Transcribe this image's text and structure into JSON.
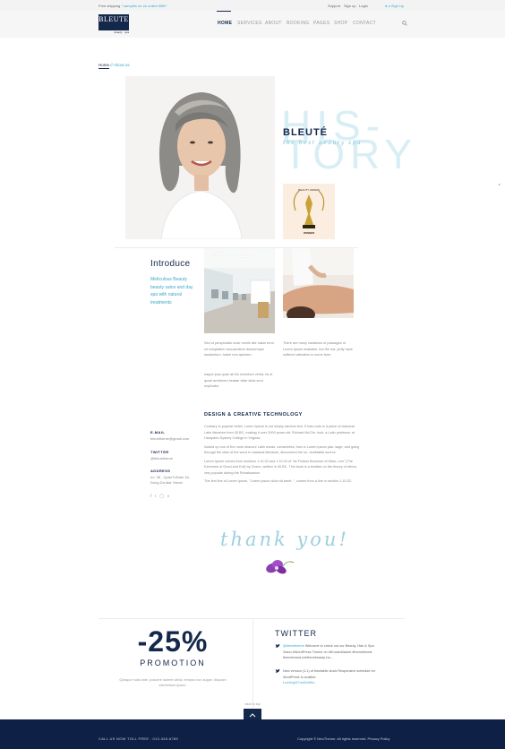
{
  "topbar": {
    "promo_prefix": "Free shipping ",
    "promo_highlight": "* samples on on orders $50+",
    "links": [
      "Support",
      "Sign up",
      "Login"
    ],
    "account": "a Sign Up"
  },
  "logo": {
    "word": "BLEUTE",
    "tagline": "beauty · spa"
  },
  "nav": {
    "items": [
      "HOME",
      "SERVICES",
      "ABOUT",
      "BOOKING",
      "PAGES",
      "SHOP",
      "CONTACT"
    ],
    "active": "HOME"
  },
  "breadcrumb": {
    "home": "Home",
    "separator": "//",
    "current": "About us"
  },
  "history": {
    "big_line1": "HIS-",
    "big_line2": "TORY",
    "brand": "BLEUTÉ",
    "script": "the best beauty spa",
    "award_top": "BEAUTY AWARD",
    "award_caption": "WINNER"
  },
  "intro": {
    "title": "Introduce",
    "text": "Meticulous Beauty beauty salon and day spa with natural treatments",
    "col1a": "Sed ut perspiciatis unde omnis iste natus error sit voluptatem accusantium doloremque laudantium, totam rem aperiam.",
    "col1b": "eaque ipsa quae ab illo inventore verita- tis et quasi architecto beatae vitae dicta sunt explicabo.",
    "col2": "There are many variations of passages of Lorem Ipsum available, but the ma- jority have suffered alteration in some form."
  },
  "contact": {
    "email_label": "E-MAIL",
    "email": "bleuetheme@gmail.com",
    "twitter_label": "TWITTER",
    "twitter": "@bleuetheme",
    "address_label": "ADDRESS",
    "address": "no. 36 , QuanTuDam 16- Dong Da dist. Hanoi"
  },
  "design": {
    "title": "DESIGN & CREATIVE TECHNOLOGY",
    "p1": "Contrary to popular belief, Lorem Ipsum is not simply random text. It has roots in a piece of classical Latin literature from 45 BC, making it over 2000 years old. Richard McClin- tock, a Latin professor at Hampden-Sydney College in Virginia.",
    "p2": "looked up one of the more obscure Latin words, consectetur, from a Lorem Ipsum pas- sage, and going through the cites of the word in classical literature, discovered the un- doubtable source.",
    "p3": "Lorem Ipsum comes from sections 1.10.32 and 1.10.33 of \"de Finibus Bonorum et Malo- rum\" (The Extremes of Good and Evil) by Cicero, written in 45 BC. This book is a treatise on the theory of ethics, very popular during the Renaissance.",
    "p4": "The first line of Lorem Ipsum, \"Lorem ipsum dolor sit amet..\", comes from a line in section 1.10.32."
  },
  "thanks": "thank you!",
  "promo": {
    "value": "-25%",
    "label": "PROMOTION",
    "note": "Quisque nulla ante, posuere laoreet ultrici, tempus non augue. Aliquam elementum ipsum."
  },
  "twitter_feed": {
    "title": "TWITTER",
    "tweets": [
      {
        "handle": "@bleuetheme",
        "text": " Welcome to check out our Beauty, Hair & Spa Salon #WordPress Theme on #EnvatoMarket #themeforest themeforest.net/item/beauty-ha..."
      },
      {
        "handle": "",
        "text": "New version (1.1) of timetable stock Responsive schedule for WordPress is availble.",
        "link": "t.co/4vq0I7uxtGv8Ho"
      }
    ]
  },
  "back_to_top": "back to top",
  "footer": {
    "call": "CALL US NOW TOLL FREE : 012-345-6789",
    "copyright": "Copyright © bleuTheme. All rights reserved. Privacy Policy"
  },
  "colors": {
    "navy": "#14284b",
    "accent": "#3aa8c9",
    "footer": "#0f2046"
  }
}
